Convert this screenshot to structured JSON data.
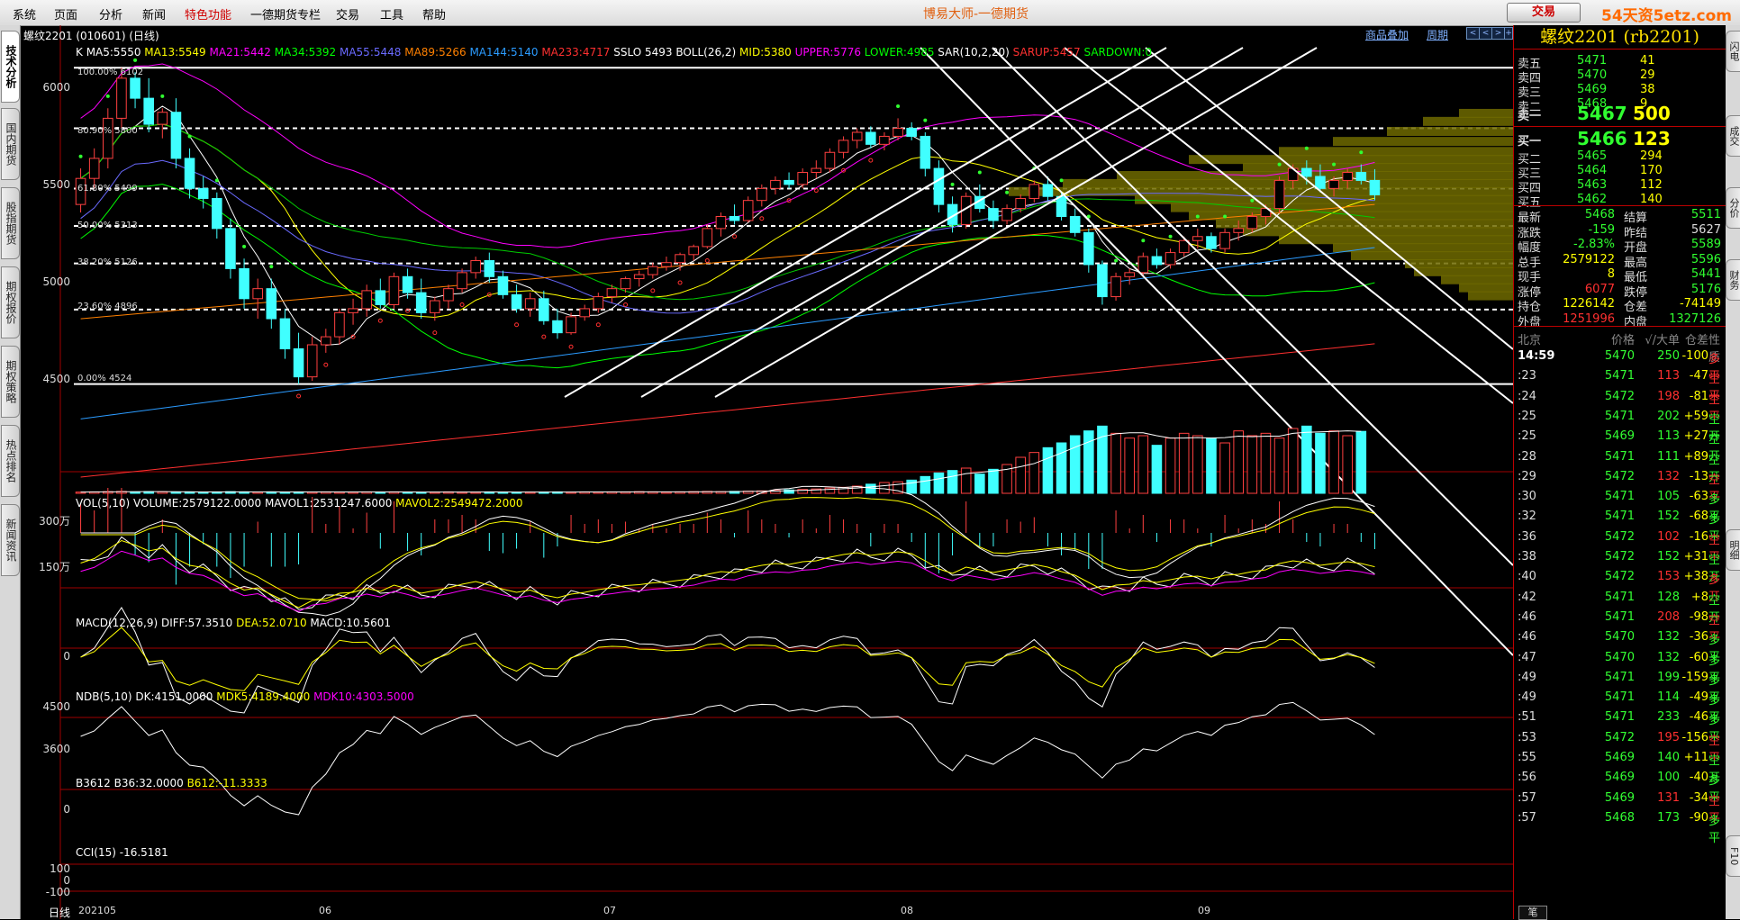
{
  "menubar": {
    "items": [
      "系统",
      "页面",
      "分析",
      "新闻",
      "特色功能",
      "一德期货专栏",
      "交易",
      "工具",
      "帮助"
    ],
    "app_title": "博易大师-一德期货",
    "trade_button": "交易",
    "logo": "54天资5etz.com"
  },
  "left_tabs": [
    "技术分析",
    "国内期货",
    "股指期货",
    "期权报价",
    "期权策略",
    "热点排名",
    "新闻资讯"
  ],
  "right_tabs": [
    "闪电",
    "成交",
    "分价",
    "财务",
    "明细",
    "F10"
  ],
  "chart_header": {
    "title": "螺纹2201 (010601) (日线)",
    "btn_overlay": "商品叠加",
    "btn_period": "周期",
    "mini_buttons": [
      "<",
      "<",
      ">",
      "+"
    ]
  },
  "indicators": {
    "main": [
      {
        "text": "K",
        "color": "#ffffff"
      },
      {
        "text": "MA5:5550",
        "color": "#ffffff"
      },
      {
        "text": "MA13:5549",
        "color": "#ffff00"
      },
      {
        "text": "MA21:5442",
        "color": "#ff00ff"
      },
      {
        "text": "MA34:5392",
        "color": "#00ff00"
      },
      {
        "text": "MA55:5448",
        "color": "#6a6aff"
      },
      {
        "text": "MA89:5266",
        "color": "#ff8000"
      },
      {
        "text": "MA144:5140",
        "color": "#2b9bff"
      },
      {
        "text": "MA233:4717",
        "color": "#ff3030"
      },
      {
        "text": "SSLO 5493",
        "color": "#ffffff"
      },
      {
        "text": "BOLL(26,2)",
        "color": "#ffffff"
      },
      {
        "text": "MID:5380",
        "color": "#ffff00"
      },
      {
        "text": "UPPER:5776",
        "color": "#ff00ff"
      },
      {
        "text": "LOWER:4985",
        "color": "#00ff00"
      },
      {
        "text": "SAR(10,2,20)",
        "color": "#ffffff"
      },
      {
        "text": "SARUP:5457",
        "color": "#ff3030"
      },
      {
        "text": "SARDOWN:0",
        "color": "#00ff00"
      }
    ],
    "vol": [
      {
        "text": "VOL(5,10)",
        "color": "#ffffff"
      },
      {
        "text": "VOLUME:2579122.0000",
        "color": "#ffffff"
      },
      {
        "text": "MAVOL1:2531247.6000",
        "color": "#ffffff"
      },
      {
        "text": "MAVOL2:2549472.2000",
        "color": "#ffff00"
      }
    ],
    "macd": [
      {
        "text": "MACD(12,26,9)",
        "color": "#ffffff"
      },
      {
        "text": "DIFF:57.3510",
        "color": "#ffffff"
      },
      {
        "text": "DEA:52.0710",
        "color": "#ffff00"
      },
      {
        "text": "MACD:10.5601",
        "color": "#ffffff"
      }
    ],
    "ndb": [
      {
        "text": "NDB(5,10)",
        "color": "#ffffff"
      },
      {
        "text": "DK:4151.0000",
        "color": "#ffffff"
      },
      {
        "text": "MDK5:4189.4000",
        "color": "#ffff00"
      },
      {
        "text": "MDK10:4303.5000",
        "color": "#ff00ff"
      }
    ],
    "b36": [
      {
        "text": "B3612",
        "color": "#ffffff"
      },
      {
        "text": "B36:32.0000",
        "color": "#ffffff"
      },
      {
        "text": "B612:-11.3333",
        "color": "#ffff00"
      }
    ],
    "cci": [
      {
        "text": "CCI(15)",
        "color": "#ffffff"
      },
      {
        "text": "-16.5181",
        "color": "#ffffff"
      }
    ]
  },
  "axes": {
    "price_ticks": [
      "6000",
      "5500",
      "5000",
      "4500"
    ],
    "vol_ticks": [
      "300万",
      "150万"
    ],
    "macd_ticks": [
      "0"
    ],
    "ndb_ticks": [
      "4500",
      "3600"
    ],
    "b36_ticks": [
      "0"
    ],
    "cci_ticks": [
      "100",
      "0",
      "-100"
    ],
    "x_label_period": "日线",
    "x_ticks": [
      "202105",
      "06",
      "07",
      "08",
      "09"
    ]
  },
  "fib_levels": [
    {
      "label": "100.00% 6102",
      "price": 6102
    },
    {
      "label": "80.90% 5800",
      "price": 5800
    },
    {
      "label": "61.80% 5499",
      "price": 5499
    },
    {
      "label": "50.00% 5313",
      "price": 5313
    },
    {
      "label": "38.20% 5126",
      "price": 5126
    },
    {
      "label": "23.60% 4896",
      "price": 4896
    },
    {
      "label": "0.00% 4524",
      "price": 4524
    }
  ],
  "chart_data": {
    "type": "candlestick",
    "symbol": "rb2201",
    "period": "daily",
    "dates_range": [
      "2021-05",
      "2021-09"
    ],
    "ylim": [
      4050,
      6200
    ],
    "candles": [
      [
        5420,
        5600,
        5380,
        5550
      ],
      [
        5550,
        5700,
        5500,
        5650
      ],
      [
        5650,
        5900,
        5600,
        5850
      ],
      [
        5850,
        6102,
        5800,
        6050
      ],
      [
        6050,
        6080,
        5900,
        5950
      ],
      [
        5950,
        6050,
        5780,
        5820
      ],
      [
        5820,
        5900,
        5750,
        5880
      ],
      [
        5880,
        5950,
        5600,
        5650
      ],
      [
        5650,
        5700,
        5450,
        5500
      ],
      [
        5500,
        5560,
        5400,
        5450
      ],
      [
        5450,
        5480,
        5250,
        5300
      ],
      [
        5300,
        5350,
        5050,
        5100
      ],
      [
        5100,
        5150,
        4900,
        4950
      ],
      [
        4950,
        5050,
        4850,
        5000
      ],
      [
        5000,
        5050,
        4800,
        4850
      ],
      [
        4850,
        4900,
        4650,
        4700
      ],
      [
        4700,
        4780,
        4524,
        4560
      ],
      [
        4560,
        4760,
        4540,
        4720
      ],
      [
        4720,
        4800,
        4680,
        4760
      ],
      [
        4760,
        4900,
        4720,
        4880
      ],
      [
        4880,
        4950,
        4820,
        4900
      ],
      [
        4900,
        5020,
        4860,
        4990
      ],
      [
        4990,
        5050,
        4900,
        4920
      ],
      [
        4920,
        5080,
        4900,
        5060
      ],
      [
        5060,
        5100,
        4950,
        4980
      ],
      [
        4980,
        5050,
        4850,
        4880
      ],
      [
        4880,
        4960,
        4840,
        4940
      ],
      [
        4940,
        5020,
        4900,
        5000
      ],
      [
        5000,
        5100,
        4980,
        5080
      ],
      [
        5080,
        5160,
        5050,
        5140
      ],
      [
        5140,
        5180,
        5030,
        5060
      ],
      [
        5060,
        5090,
        4950,
        4970
      ],
      [
        4970,
        5020,
        4880,
        4900
      ],
      [
        4900,
        4980,
        4860,
        4950
      ],
      [
        4950,
        4990,
        4820,
        4840
      ],
      [
        4840,
        4900,
        4750,
        4780
      ],
      [
        4780,
        4880,
        4770,
        4860
      ],
      [
        4860,
        4920,
        4840,
        4900
      ],
      [
        4900,
        4980,
        4880,
        4960
      ],
      [
        4960,
        5020,
        4930,
        5000
      ],
      [
        5000,
        5060,
        4980,
        5050
      ],
      [
        5050,
        5090,
        5010,
        5070
      ],
      [
        5070,
        5130,
        5050,
        5110
      ],
      [
        5110,
        5160,
        5090,
        5130
      ],
      [
        5130,
        5180,
        5090,
        5170
      ],
      [
        5170,
        5220,
        5140,
        5210
      ],
      [
        5210,
        5320,
        5200,
        5300
      ],
      [
        5300,
        5380,
        5260,
        5360
      ],
      [
        5360,
        5420,
        5320,
        5340
      ],
      [
        5340,
        5460,
        5330,
        5440
      ],
      [
        5440,
        5520,
        5410,
        5500
      ],
      [
        5500,
        5560,
        5470,
        5540
      ],
      [
        5540,
        5580,
        5500,
        5520
      ],
      [
        5520,
        5600,
        5500,
        5580
      ],
      [
        5580,
        5640,
        5550,
        5600
      ],
      [
        5600,
        5700,
        5580,
        5680
      ],
      [
        5680,
        5760,
        5650,
        5740
      ],
      [
        5740,
        5800,
        5700,
        5780
      ],
      [
        5780,
        5810,
        5700,
        5720
      ],
      [
        5720,
        5780,
        5690,
        5760
      ],
      [
        5760,
        5850,
        5740,
        5800
      ],
      [
        5800,
        5830,
        5740,
        5760
      ],
      [
        5760,
        5780,
        5560,
        5600
      ],
      [
        5600,
        5640,
        5380,
        5420
      ],
      [
        5420,
        5460,
        5280,
        5320
      ],
      [
        5320,
        5480,
        5300,
        5460
      ],
      [
        5460,
        5520,
        5380,
        5400
      ],
      [
        5400,
        5440,
        5300,
        5340
      ],
      [
        5340,
        5420,
        5320,
        5400
      ],
      [
        5400,
        5470,
        5380,
        5450
      ],
      [
        5450,
        5540,
        5430,
        5520
      ],
      [
        5520,
        5560,
        5440,
        5460
      ],
      [
        5460,
        5480,
        5340,
        5360
      ],
      [
        5360,
        5400,
        5260,
        5280
      ],
      [
        5280,
        5300,
        5080,
        5120
      ],
      [
        5120,
        5140,
        4920,
        4960
      ],
      [
        4960,
        5080,
        4940,
        5060
      ],
      [
        5060,
        5100,
        5020,
        5080
      ],
      [
        5080,
        5180,
        5060,
        5160
      ],
      [
        5160,
        5200,
        5100,
        5120
      ],
      [
        5120,
        5200,
        5100,
        5180
      ],
      [
        5180,
        5260,
        5160,
        5240
      ],
      [
        5240,
        5300,
        5200,
        5260
      ],
      [
        5260,
        5280,
        5180,
        5200
      ],
      [
        5200,
        5300,
        5180,
        5280
      ],
      [
        5280,
        5340,
        5240,
        5300
      ],
      [
        5300,
        5380,
        5280,
        5360
      ],
      [
        5360,
        5420,
        5320,
        5400
      ],
      [
        5400,
        5560,
        5380,
        5540
      ],
      [
        5540,
        5620,
        5500,
        5600
      ],
      [
        5600,
        5640,
        5520,
        5560
      ],
      [
        5560,
        5620,
        5480,
        5500
      ],
      [
        5500,
        5560,
        5460,
        5540
      ],
      [
        5540,
        5600,
        5500,
        5580
      ],
      [
        5580,
        5620,
        5520,
        5540
      ],
      [
        5540,
        5596,
        5441,
        5468
      ]
    ],
    "volumes_wan": [
      5,
      6,
      7,
      8,
      6,
      7,
      6,
      5,
      6,
      5,
      6,
      7,
      6,
      5,
      6,
      5,
      6,
      5,
      6,
      5,
      5,
      6,
      5,
      6,
      5,
      4,
      5,
      6,
      5,
      5,
      6,
      5,
      4,
      5,
      5,
      6,
      5,
      6,
      5,
      6,
      6,
      7,
      6,
      5,
      6,
      7,
      8,
      7,
      8,
      9,
      10,
      12,
      14,
      16,
      18,
      22,
      25,
      30,
      38,
      45,
      48,
      55,
      70,
      85,
      95,
      105,
      80,
      100,
      120,
      150,
      170,
      190,
      210,
      240,
      260,
      280,
      250,
      230,
      240,
      200,
      230,
      250,
      240,
      230,
      210,
      260,
      240,
      250,
      230,
      270,
      280,
      250,
      260,
      240,
      258
    ]
  },
  "quote": {
    "title": "螺纹2201 (rb2201)",
    "asks": [
      {
        "label": "卖五",
        "price": "5471",
        "vol": "41"
      },
      {
        "label": "卖四",
        "price": "5470",
        "vol": "29"
      },
      {
        "label": "卖三",
        "price": "5469",
        "vol": "38"
      },
      {
        "label": "卖二",
        "price": "5468",
        "vol": "9"
      },
      {
        "label": "卖一",
        "price": "5467",
        "vol": "500"
      }
    ],
    "bids": [
      {
        "label": "买一",
        "price": "5466",
        "vol": "123"
      },
      {
        "label": "买二",
        "price": "5465",
        "vol": "294"
      },
      {
        "label": "买三",
        "price": "5464",
        "vol": "170"
      },
      {
        "label": "买四",
        "price": "5463",
        "vol": "112"
      },
      {
        "label": "买五",
        "price": "5462",
        "vol": "140"
      }
    ],
    "stats": [
      {
        "l1": "最新",
        "v1": "5468",
        "c1": "grn",
        "l2": "结算",
        "v2": "5511",
        "c2": "grn"
      },
      {
        "l1": "涨跌",
        "v1": "-159",
        "c1": "grn",
        "l2": "昨结",
        "v2": "5627",
        "c2": "wht"
      },
      {
        "l1": "幅度",
        "v1": "-2.83%",
        "c1": "grn",
        "l2": "开盘",
        "v2": "5589",
        "c2": "grn"
      },
      {
        "l1": "总手",
        "v1": "2579122",
        "c1": "yel",
        "l2": "最高",
        "v2": "5596",
        "c2": "grn"
      },
      {
        "l1": "现手",
        "v1": "8",
        "c1": "yel",
        "l2": "最低",
        "v2": "5441",
        "c2": "grn"
      },
      {
        "l1": "涨停",
        "v1": "6077",
        "c1": "red",
        "l2": "跌停",
        "v2": "5176",
        "c2": "grn"
      },
      {
        "l1": "持仓",
        "v1": "1226142",
        "c1": "yel",
        "l2": "仓差",
        "v2": "-74149",
        "c2": "yel"
      },
      {
        "l1": "外盘",
        "v1": "1251996",
        "c1": "red",
        "l2": "内盘",
        "v2": "1327126",
        "c2": "grn"
      }
    ],
    "tick_header": {
      "time": "北京",
      "price": "价格",
      "vol": "√/大单",
      "chg": "仓差",
      "nature": "性质"
    },
    "ticks": [
      {
        "t": "14:59",
        "p": "5470",
        "v": "250",
        "vc": "grn",
        "c": "-100",
        "cc": "yel",
        "n": "多平",
        "nc": "red"
      },
      {
        "t": ":23",
        "p": "5471",
        "v": "113",
        "vc": "red",
        "c": "-47",
        "cc": "yel",
        "n": "空平",
        "nc": "red"
      },
      {
        "t": ":24",
        "p": "5472",
        "v": "198",
        "vc": "red",
        "c": "-81",
        "cc": "yel",
        "n": "空平",
        "nc": "red"
      },
      {
        "t": ":25",
        "p": "5471",
        "v": "202",
        "vc": "grn",
        "c": "+59",
        "cc": "yel",
        "n": "空开",
        "nc": "grn"
      },
      {
        "t": ":25",
        "p": "5469",
        "v": "113",
        "vc": "grn",
        "c": "+27",
        "cc": "yel",
        "n": "空开",
        "nc": "grn"
      },
      {
        "t": ":28",
        "p": "5471",
        "v": "111",
        "vc": "grn",
        "c": "+89",
        "cc": "yel",
        "n": "空开",
        "nc": "grn"
      },
      {
        "t": ":29",
        "p": "5472",
        "v": "132",
        "vc": "red",
        "c": "-13",
        "cc": "yel",
        "n": "空平",
        "nc": "red"
      },
      {
        "t": ":30",
        "p": "5471",
        "v": "105",
        "vc": "grn",
        "c": "-63",
        "cc": "yel",
        "n": "多平",
        "nc": "grn"
      },
      {
        "t": ":32",
        "p": "5471",
        "v": "152",
        "vc": "grn",
        "c": "-68",
        "cc": "yel",
        "n": "多平",
        "nc": "grn"
      },
      {
        "t": ":36",
        "p": "5472",
        "v": "102",
        "vc": "red",
        "c": "-16",
        "cc": "yel",
        "n": "空平",
        "nc": "red"
      },
      {
        "t": ":38",
        "p": "5472",
        "v": "152",
        "vc": "grn",
        "c": "+31",
        "cc": "yel",
        "n": "空开",
        "nc": "grn"
      },
      {
        "t": ":40",
        "p": "5472",
        "v": "153",
        "vc": "red",
        "c": "+38",
        "cc": "yel",
        "n": "多开",
        "nc": "red"
      },
      {
        "t": ":42",
        "p": "5471",
        "v": "128",
        "vc": "grn",
        "c": "+8",
        "cc": "yel",
        "n": "空开",
        "nc": "grn"
      },
      {
        "t": ":46",
        "p": "5471",
        "v": "208",
        "vc": "red",
        "c": "-98",
        "cc": "yel",
        "n": "空平",
        "nc": "red"
      },
      {
        "t": ":46",
        "p": "5470",
        "v": "132",
        "vc": "grn",
        "c": "-36",
        "cc": "yel",
        "n": "多平",
        "nc": "grn"
      },
      {
        "t": ":47",
        "p": "5470",
        "v": "132",
        "vc": "grn",
        "c": "-60",
        "cc": "yel",
        "n": "多平",
        "nc": "grn"
      },
      {
        "t": ":49",
        "p": "5471",
        "v": "199",
        "vc": "grn",
        "c": "-159",
        "cc": "yel",
        "n": "多平",
        "nc": "grn"
      },
      {
        "t": ":49",
        "p": "5471",
        "v": "114",
        "vc": "grn",
        "c": "-49",
        "cc": "yel",
        "n": "多平",
        "nc": "grn"
      },
      {
        "t": ":51",
        "p": "5471",
        "v": "233",
        "vc": "grn",
        "c": "-46",
        "cc": "yel",
        "n": "多平",
        "nc": "grn"
      },
      {
        "t": ":53",
        "p": "5472",
        "v": "195",
        "vc": "red",
        "c": "-156",
        "cc": "yel",
        "n": "空平",
        "nc": "red"
      },
      {
        "t": ":55",
        "p": "5469",
        "v": "140",
        "vc": "grn",
        "c": "+11",
        "cc": "yel",
        "n": "空开",
        "nc": "grn"
      },
      {
        "t": ":56",
        "p": "5469",
        "v": "100",
        "vc": "grn",
        "c": "-40",
        "cc": "yel",
        "n": "多平",
        "nc": "grn"
      },
      {
        "t": ":57",
        "p": "5469",
        "v": "131",
        "vc": "red",
        "c": "-34",
        "cc": "yel",
        "n": "空平",
        "nc": "red"
      },
      {
        "t": ":57",
        "p": "5468",
        "v": "173",
        "vc": "grn",
        "c": "-90",
        "cc": "yel",
        "n": "多平",
        "nc": "grn"
      }
    ],
    "bottom_tab": "笔"
  }
}
